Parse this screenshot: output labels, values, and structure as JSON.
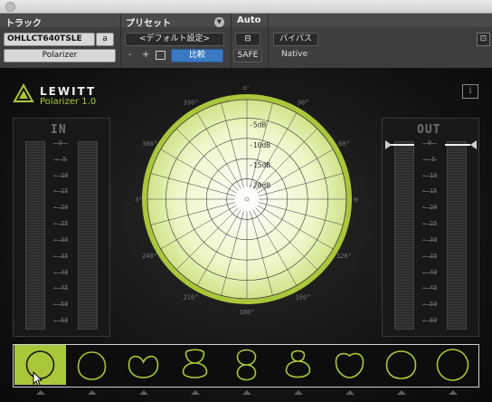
{
  "host": {
    "track_label": "トラック",
    "preset_label": "プリセット",
    "auto_label": "Auto",
    "track_name": "OHLLCT640TSLE",
    "track_channel": "a",
    "plugin_slot": "Polarizer",
    "preset_name": "<デフォルト設定>",
    "minus": "-",
    "plus": "+",
    "compare": "比較",
    "safe": "SAFE",
    "bypass": "バイパス",
    "native": "Native"
  },
  "plugin": {
    "brand": "LEWITT",
    "product": "Polarizer 1.0",
    "info": "i",
    "in_title": "IN",
    "out_title": "OUT",
    "meter_scale": [
      "0",
      "- 5",
      "- 10",
      "- 15",
      "- 20",
      "- 25",
      "- 30",
      "- 35",
      "- 40",
      "- 45",
      "- 50",
      "- 60"
    ],
    "polar_degrees": [
      "0°",
      "30°",
      "60°",
      "90°",
      "120°",
      "150°",
      "180°",
      "210°",
      "240°",
      "270°",
      "300°",
      "330°"
    ],
    "polar_db": [
      "-5dB",
      "-10dB",
      "-15dB",
      "-20dB"
    ],
    "patterns": [
      "omni",
      "wide-cardioid",
      "cardioid",
      "supercardioid",
      "figure-8",
      "supercardioid-rear",
      "cardioid-rear",
      "wide-cardioid-rear",
      "omni-large"
    ],
    "selected_pattern_index": 0
  },
  "colors": {
    "accent": "#a9c73a",
    "polar_fill": "#e7f3b3",
    "header_bg": "#4a4a4a"
  }
}
